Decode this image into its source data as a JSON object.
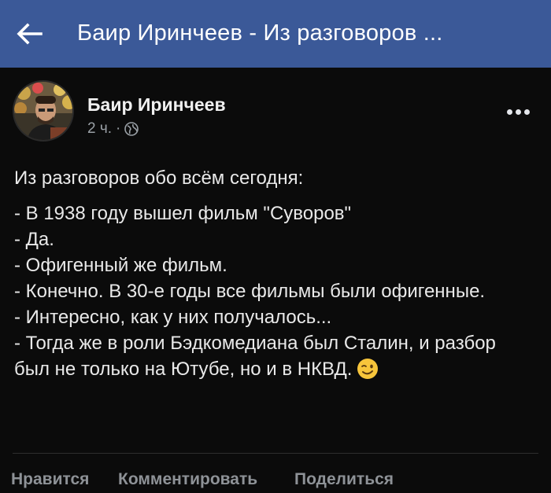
{
  "header": {
    "title": "Баир Иринчеев - Из разговоров ...",
    "back_icon": "arrow-left-icon",
    "background": "#3b5998"
  },
  "post": {
    "author": "Баир Иринчеев",
    "time": "2 ч.",
    "separator": "·",
    "privacy_icon": "globe-icon",
    "more_icon": "more-horizontal-icon",
    "intro": "Из разговоров обо всём сегодня:",
    "lines": [
      "- В 1938 году вышел фильм \"Суворов\"",
      "- Да.",
      "- Офигенный же фильм.",
      "- Конечно. В 30-е годы все фильмы были офигенные.",
      "- Интересно, как у них получалось...",
      "- Тогда же в роли Бэдкомедиана был Сталин, и разбор был не только на Ютубе, но и в НКВД."
    ],
    "emoji": "winking-face-emoji"
  },
  "actions": {
    "like": "Нравится",
    "comment": "Комментировать",
    "share": "Поделиться"
  }
}
